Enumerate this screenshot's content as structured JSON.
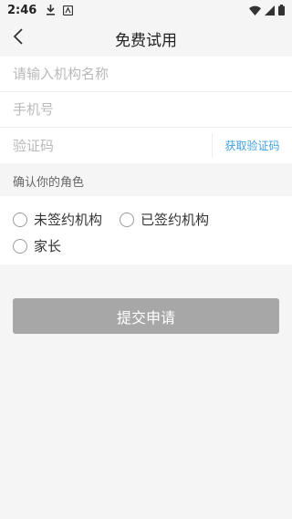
{
  "status_bar": {
    "time": "2:46",
    "icons": [
      "download-icon",
      "app-notification-icon",
      "wifi-icon",
      "signal-icon",
      "battery-icon"
    ]
  },
  "nav": {
    "back_icon": "chevron-left-icon",
    "title": "免费试用"
  },
  "form": {
    "org_name_placeholder": "请输入机构名称",
    "phone_placeholder": "手机号",
    "code_placeholder": "验证码",
    "get_code_label": "获取验证码"
  },
  "roles": {
    "header": "确认你的角色",
    "options": [
      {
        "label": "未签约机构",
        "selected": false
      },
      {
        "label": "已签约机构",
        "selected": false
      },
      {
        "label": "家长",
        "selected": false
      }
    ]
  },
  "submit_label": "提交申请",
  "colors": {
    "background": "#f5f5f5",
    "link": "#3f9fe0",
    "button_disabled": "#a7a7a7"
  }
}
